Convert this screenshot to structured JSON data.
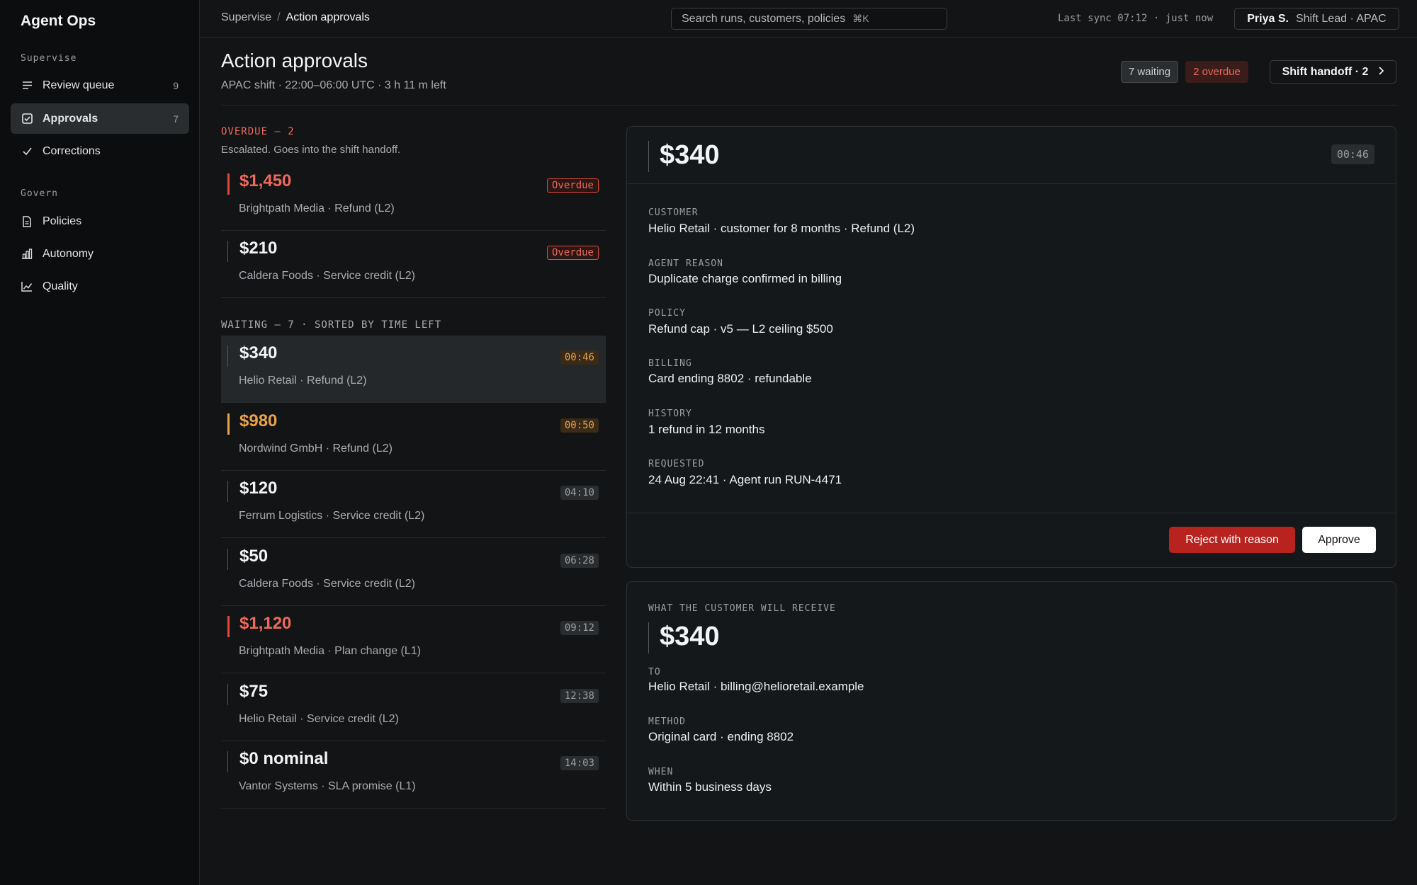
{
  "app": {
    "name": "Agent Ops"
  },
  "sidebar": {
    "sections": [
      {
        "label": "Supervise",
        "items": [
          {
            "label": "Review queue",
            "count": "9",
            "icon": "list-icon"
          },
          {
            "label": "Approvals",
            "count": "7",
            "icon": "checkbox-icon",
            "active": true
          },
          {
            "label": "Corrections",
            "count": "",
            "icon": "check-icon"
          }
        ]
      },
      {
        "label": "Govern",
        "items": [
          {
            "label": "Policies",
            "icon": "document-icon"
          },
          {
            "label": "Autonomy",
            "icon": "bar-chart-icon"
          },
          {
            "label": "Quality",
            "icon": "line-chart-icon"
          }
        ]
      }
    ]
  },
  "topbar": {
    "breadcrumb": [
      "Supervise",
      "Action approvals"
    ],
    "search_placeholder": "Search runs, customers, policies",
    "search_shortcut": "⌘K",
    "sync": "Last sync 07:12 · just now",
    "user_name": "Priya S.",
    "user_role": "Shift Lead · APAC"
  },
  "header": {
    "title": "Action approvals",
    "subtitle": "APAC shift · 22:00–06:00 UTC · 3 h 11 m left",
    "waiting": "7 waiting",
    "overdue": "2 overdue",
    "handoff": "Shift handoff · 2"
  },
  "overdue_group": {
    "label": "OVERDUE — 2",
    "sub": "Escalated. Goes into the shift handoff.",
    "items": [
      {
        "amount": "$1,450",
        "meta": "Brightpath Media · Refund (L2)",
        "tag": "Overdue"
      },
      {
        "amount": "$210",
        "meta": "Caldera Foods · Service credit (L2)",
        "tag": "Overdue"
      }
    ]
  },
  "waiting_group": {
    "label": "WAITING — 7 · SORTED BY TIME LEFT",
    "items": [
      {
        "amount": "$340",
        "meta": "Helio Retail · Refund (L2)",
        "timer": "00:46"
      },
      {
        "amount": "$980",
        "meta": "Nordwind GmbH · Refund (L2)",
        "timer": "00:50"
      },
      {
        "amount": "$120",
        "meta": "Ferrum Logistics · Service credit (L2)",
        "timer": "04:10"
      },
      {
        "amount": "$50",
        "meta": "Caldera Foods · Service credit (L2)",
        "timer": "06:28"
      },
      {
        "amount": "$1,120",
        "meta": "Brightpath Media · Plan change (L1)",
        "timer": "09:12"
      },
      {
        "amount": "$75",
        "meta": "Helio Retail · Service credit (L2)",
        "timer": "12:38"
      },
      {
        "amount": "$0 nominal",
        "meta": "Vantor Systems · SLA promise (L1)",
        "timer": "14:03"
      }
    ]
  },
  "detail": {
    "amount": "$340",
    "timer": "00:46",
    "fields": [
      {
        "label": "CUSTOMER",
        "value": "Helio Retail · customer for 8 months · Refund (L2)"
      },
      {
        "label": "AGENT REASON",
        "value": "Duplicate charge confirmed in billing"
      },
      {
        "label": "POLICY",
        "value": "Refund cap · v5 — L2 ceiling $500"
      },
      {
        "label": "BILLING",
        "value": "Card ending 8802 · refundable"
      },
      {
        "label": "HISTORY",
        "value": "1 refund in 12 months"
      },
      {
        "label": "REQUESTED",
        "value": "24 Aug 22:41 · Agent run RUN-4471"
      }
    ],
    "reject_label": "Reject with reason",
    "approve_label": "Approve"
  },
  "receive": {
    "label": "WHAT THE CUSTOMER WILL RECEIVE",
    "amount": "$340",
    "fields": [
      {
        "label": "TO",
        "value": "Helio Retail · billing@helioretail.example"
      },
      {
        "label": "METHOD",
        "value": "Original card · ending 8802"
      },
      {
        "label": "WHEN",
        "value": "Within 5 business days"
      }
    ]
  },
  "colors": {
    "reject": "#b8231f",
    "overdue": "#ee6a5c",
    "warn": "#e7a24a"
  }
}
